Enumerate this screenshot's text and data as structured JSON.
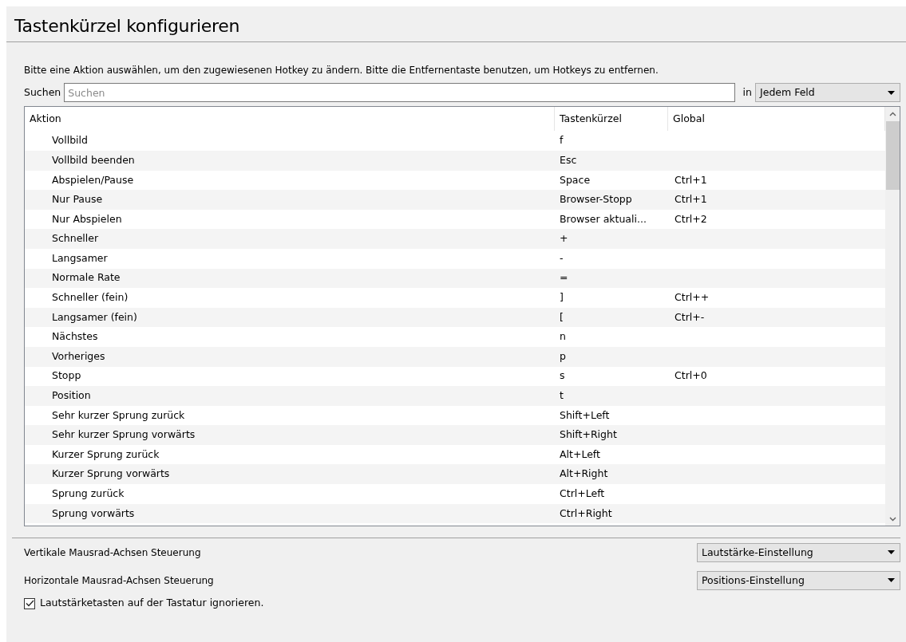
{
  "title": "Tastenkürzel konfigurieren",
  "description": "Bitte eine Aktion auswählen, um den zugewiesenen Hotkey zu ändern. Bitte die Entfernentaste benutzen, um Hotkeys zu entfernen.",
  "search": {
    "label": "Suchen",
    "placeholder": "Suchen",
    "in_label": "in",
    "scope": "Jedem Feld"
  },
  "table": {
    "columns": [
      "Aktion",
      "Tastenkürzel",
      "Global"
    ],
    "rows": [
      {
        "action": "Vollbild",
        "shortcut": "f",
        "global": ""
      },
      {
        "action": "Vollbild beenden",
        "shortcut": "Esc",
        "global": ""
      },
      {
        "action": "Abspielen/Pause",
        "shortcut": "Space",
        "global": "Ctrl+1"
      },
      {
        "action": "Nur Pause",
        "shortcut": "Browser-Stopp",
        "global": "Ctrl+1"
      },
      {
        "action": "Nur Abspielen",
        "shortcut": "Browser aktuali...",
        "global": "Ctrl+2"
      },
      {
        "action": "Schneller",
        "shortcut": "+",
        "global": ""
      },
      {
        "action": "Langsamer",
        "shortcut": "-",
        "global": ""
      },
      {
        "action": "Normale Rate",
        "shortcut": "=",
        "global": ""
      },
      {
        "action": "Schneller (fein)",
        "shortcut": "]",
        "global": "Ctrl++"
      },
      {
        "action": "Langsamer (fein)",
        "shortcut": "[",
        "global": "Ctrl+-"
      },
      {
        "action": "Nächstes",
        "shortcut": "n",
        "global": ""
      },
      {
        "action": "Vorheriges",
        "shortcut": "p",
        "global": ""
      },
      {
        "action": "Stopp",
        "shortcut": "s",
        "global": "Ctrl+0"
      },
      {
        "action": "Position",
        "shortcut": "t",
        "global": ""
      },
      {
        "action": "Sehr kurzer Sprung zurück",
        "shortcut": "Shift+Left",
        "global": ""
      },
      {
        "action": "Sehr kurzer Sprung vorwärts",
        "shortcut": "Shift+Right",
        "global": ""
      },
      {
        "action": "Kurzer Sprung zurück",
        "shortcut": "Alt+Left",
        "global": ""
      },
      {
        "action": "Kurzer Sprung vorwärts",
        "shortcut": "Alt+Right",
        "global": ""
      },
      {
        "action": "Sprung zurück",
        "shortcut": "Ctrl+Left",
        "global": ""
      },
      {
        "action": "Sprung vorwärts",
        "shortcut": "Ctrl+Right",
        "global": ""
      }
    ]
  },
  "settings": [
    {
      "label": "Vertikale Mausrad-Achsen Steuerung",
      "value": "Lautstärke-Einstellung"
    },
    {
      "label": "Horizontale Mausrad-Achsen Steuerung",
      "value": "Positions-Einstellung"
    }
  ],
  "checkbox": {
    "label": "Lautstärketasten auf der Tastatur ignorieren.",
    "checked": true
  }
}
